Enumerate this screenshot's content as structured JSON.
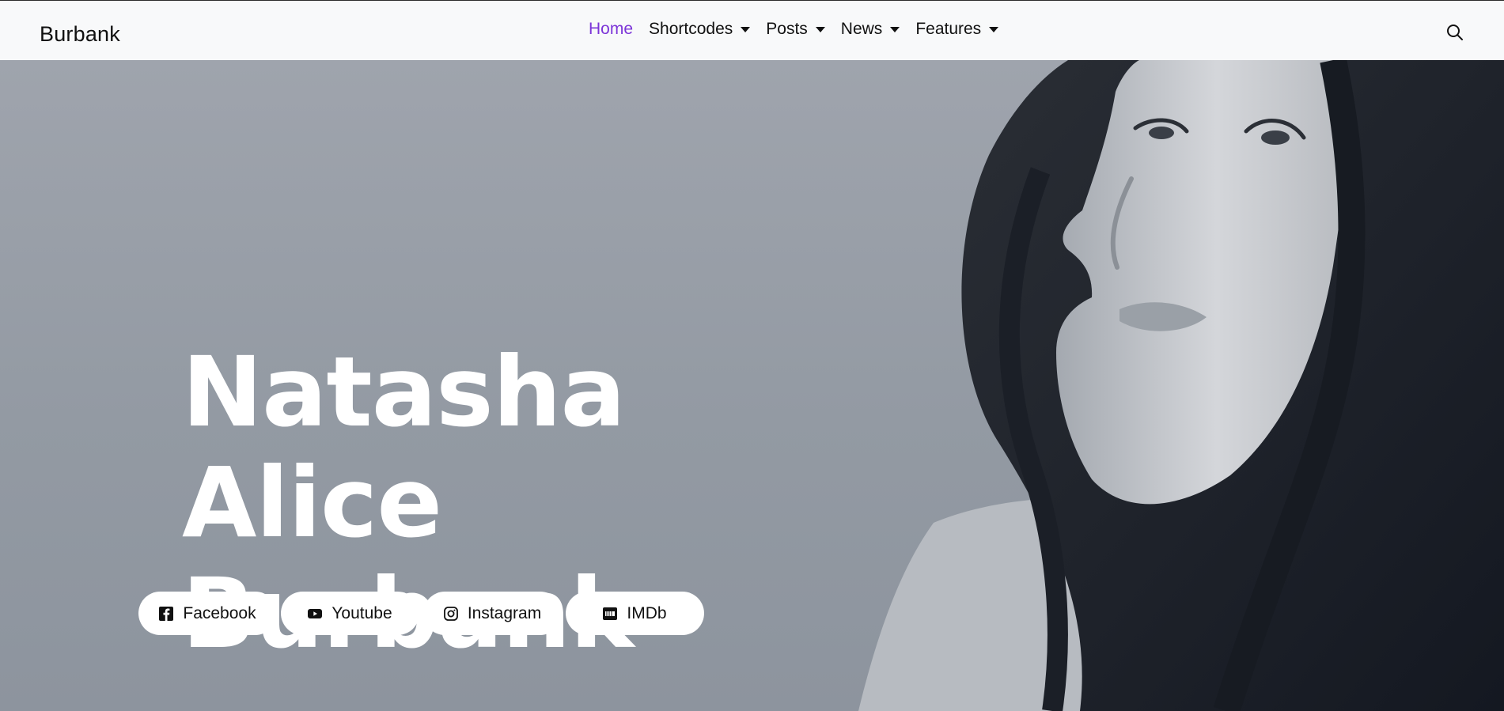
{
  "brand": {
    "name": "Burbank"
  },
  "nav": {
    "items": [
      {
        "label": "Home",
        "active": true,
        "dropdown": false
      },
      {
        "label": "Shortcodes",
        "active": false,
        "dropdown": true
      },
      {
        "label": "Posts",
        "active": false,
        "dropdown": true
      },
      {
        "label": "News",
        "active": false,
        "dropdown": true
      },
      {
        "label": "Features",
        "active": false,
        "dropdown": true
      }
    ],
    "active_color": "#7c35d8"
  },
  "hero": {
    "title_line1": "Natasha Alice",
    "title_line2": "Burbank",
    "social": [
      {
        "label": "Facebook",
        "icon": "facebook-icon"
      },
      {
        "label": "Youtube",
        "icon": "youtube-icon"
      },
      {
        "label": "Instagram",
        "icon": "instagram-icon"
      },
      {
        "label": "IMDb",
        "icon": "imdb-icon"
      }
    ]
  }
}
